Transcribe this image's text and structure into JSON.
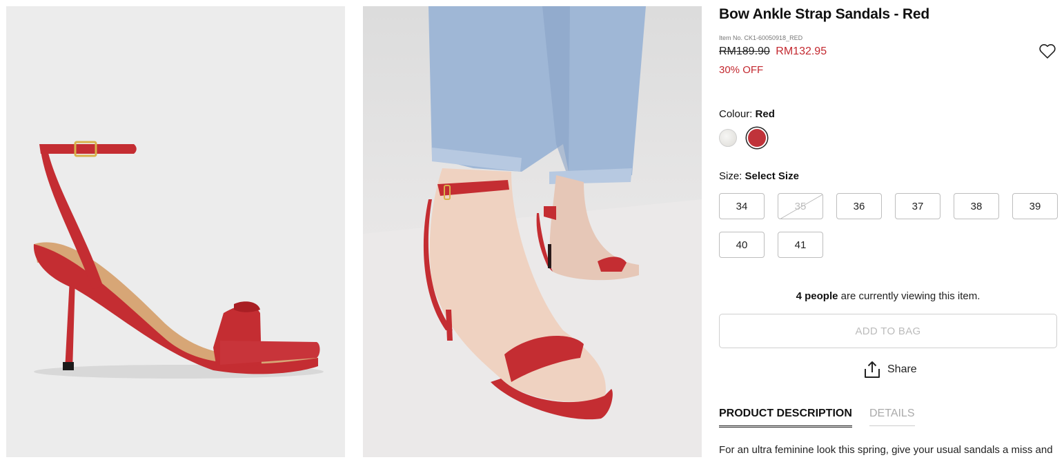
{
  "product": {
    "title": "Bow Ankle Strap Sandals - Red",
    "item_no": "Item No. CK1-60050918_RED",
    "price_old": "RM189.90",
    "price_new": "RM132.95",
    "discount": "30% OFF"
  },
  "colour": {
    "label": "Colour:",
    "selected": "Red",
    "options": [
      "white",
      "red"
    ]
  },
  "size": {
    "label": "Size:",
    "selected": "Select Size",
    "options": [
      {
        "value": "34",
        "available": true
      },
      {
        "value": "35",
        "available": false
      },
      {
        "value": "36",
        "available": true
      },
      {
        "value": "37",
        "available": true
      },
      {
        "value": "38",
        "available": true
      },
      {
        "value": "39",
        "available": true
      },
      {
        "value": "40",
        "available": true
      },
      {
        "value": "41",
        "available": true
      }
    ]
  },
  "viewing": {
    "count_text": "4 people",
    "suffix": "are currently viewing this item."
  },
  "actions": {
    "add_to_bag": "ADD TO BAG",
    "share": "Share"
  },
  "tabs": {
    "description": "PRODUCT DESCRIPTION",
    "details": "DETAILS"
  },
  "description_text": "For an ultra feminine look this spring, give your usual sandals a miss and",
  "colors": {
    "accent_red": "#c3282f",
    "swatch_red": "#c0333a"
  },
  "icons": {
    "wishlist": "heart-icon",
    "share": "share-upload-icon"
  }
}
